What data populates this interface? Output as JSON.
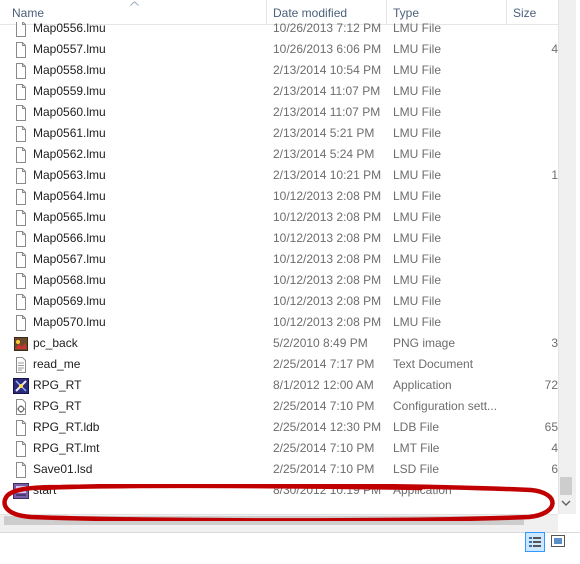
{
  "header": {
    "name": "Name",
    "date_modified": "Date modified",
    "type": "Type",
    "size": "Size"
  },
  "files": [
    {
      "name": "Map0556.lmu",
      "date": "10/26/2013 7:12 PM",
      "type": "LMU File",
      "size": "",
      "icon": "document-icon"
    },
    {
      "name": "Map0557.lmu",
      "date": "10/26/2013 6:06 PM",
      "type": "LMU File",
      "size": "4",
      "icon": "document-icon"
    },
    {
      "name": "Map0558.lmu",
      "date": "2/13/2014 10:54 PM",
      "type": "LMU File",
      "size": "",
      "icon": "document-icon"
    },
    {
      "name": "Map0559.lmu",
      "date": "2/13/2014 11:07 PM",
      "type": "LMU File",
      "size": "",
      "icon": "document-icon"
    },
    {
      "name": "Map0560.lmu",
      "date": "2/13/2014 11:07 PM",
      "type": "LMU File",
      "size": "",
      "icon": "document-icon"
    },
    {
      "name": "Map0561.lmu",
      "date": "2/13/2014 5:21 PM",
      "type": "LMU File",
      "size": "",
      "icon": "document-icon"
    },
    {
      "name": "Map0562.lmu",
      "date": "2/13/2014 5:24 PM",
      "type": "LMU File",
      "size": "",
      "icon": "document-icon"
    },
    {
      "name": "Map0563.lmu",
      "date": "2/13/2014 10:21 PM",
      "type": "LMU File",
      "size": "1",
      "icon": "document-icon"
    },
    {
      "name": "Map0564.lmu",
      "date": "10/12/2013 2:08 PM",
      "type": "LMU File",
      "size": "",
      "icon": "document-icon"
    },
    {
      "name": "Map0565.lmu",
      "date": "10/12/2013 2:08 PM",
      "type": "LMU File",
      "size": "",
      "icon": "document-icon"
    },
    {
      "name": "Map0566.lmu",
      "date": "10/12/2013 2:08 PM",
      "type": "LMU File",
      "size": "",
      "icon": "document-icon"
    },
    {
      "name": "Map0567.lmu",
      "date": "10/12/2013 2:08 PM",
      "type": "LMU File",
      "size": "",
      "icon": "document-icon"
    },
    {
      "name": "Map0568.lmu",
      "date": "10/12/2013 2:08 PM",
      "type": "LMU File",
      "size": "",
      "icon": "document-icon"
    },
    {
      "name": "Map0569.lmu",
      "date": "10/12/2013 2:08 PM",
      "type": "LMU File",
      "size": "",
      "icon": "document-icon"
    },
    {
      "name": "Map0570.lmu",
      "date": "10/12/2013 2:08 PM",
      "type": "LMU File",
      "size": "",
      "icon": "document-icon"
    },
    {
      "name": "pc_back",
      "date": "5/2/2010 8:49 PM",
      "type": "PNG image",
      "size": "3",
      "icon": "image-file-icon"
    },
    {
      "name": "read_me",
      "date": "2/25/2014 7:17 PM",
      "type": "Text Document",
      "size": "",
      "icon": "text-file-icon"
    },
    {
      "name": "RPG_RT",
      "date": "8/1/2012 12:00 AM",
      "type": "Application",
      "size": "72",
      "icon": "rpg-app-icon"
    },
    {
      "name": "RPG_RT",
      "date": "2/25/2014 7:10 PM",
      "type": "Configuration sett...",
      "size": "",
      "icon": "config-file-icon"
    },
    {
      "name": "RPG_RT.ldb",
      "date": "2/25/2014 12:30 PM",
      "type": "LDB File",
      "size": "65",
      "icon": "document-icon"
    },
    {
      "name": "RPG_RT.lmt",
      "date": "2/25/2014 7:10 PM",
      "type": "LMT File",
      "size": "4",
      "icon": "document-icon"
    },
    {
      "name": "Save01.lsd",
      "date": "2/25/2014 7:10 PM",
      "type": "LSD File",
      "size": "6",
      "icon": "document-icon"
    },
    {
      "name": "start",
      "date": "8/30/2012 10:19 PM",
      "type": "Application",
      "size": "",
      "icon": "start-app-icon"
    }
  ],
  "annotation_color": "#c00000"
}
